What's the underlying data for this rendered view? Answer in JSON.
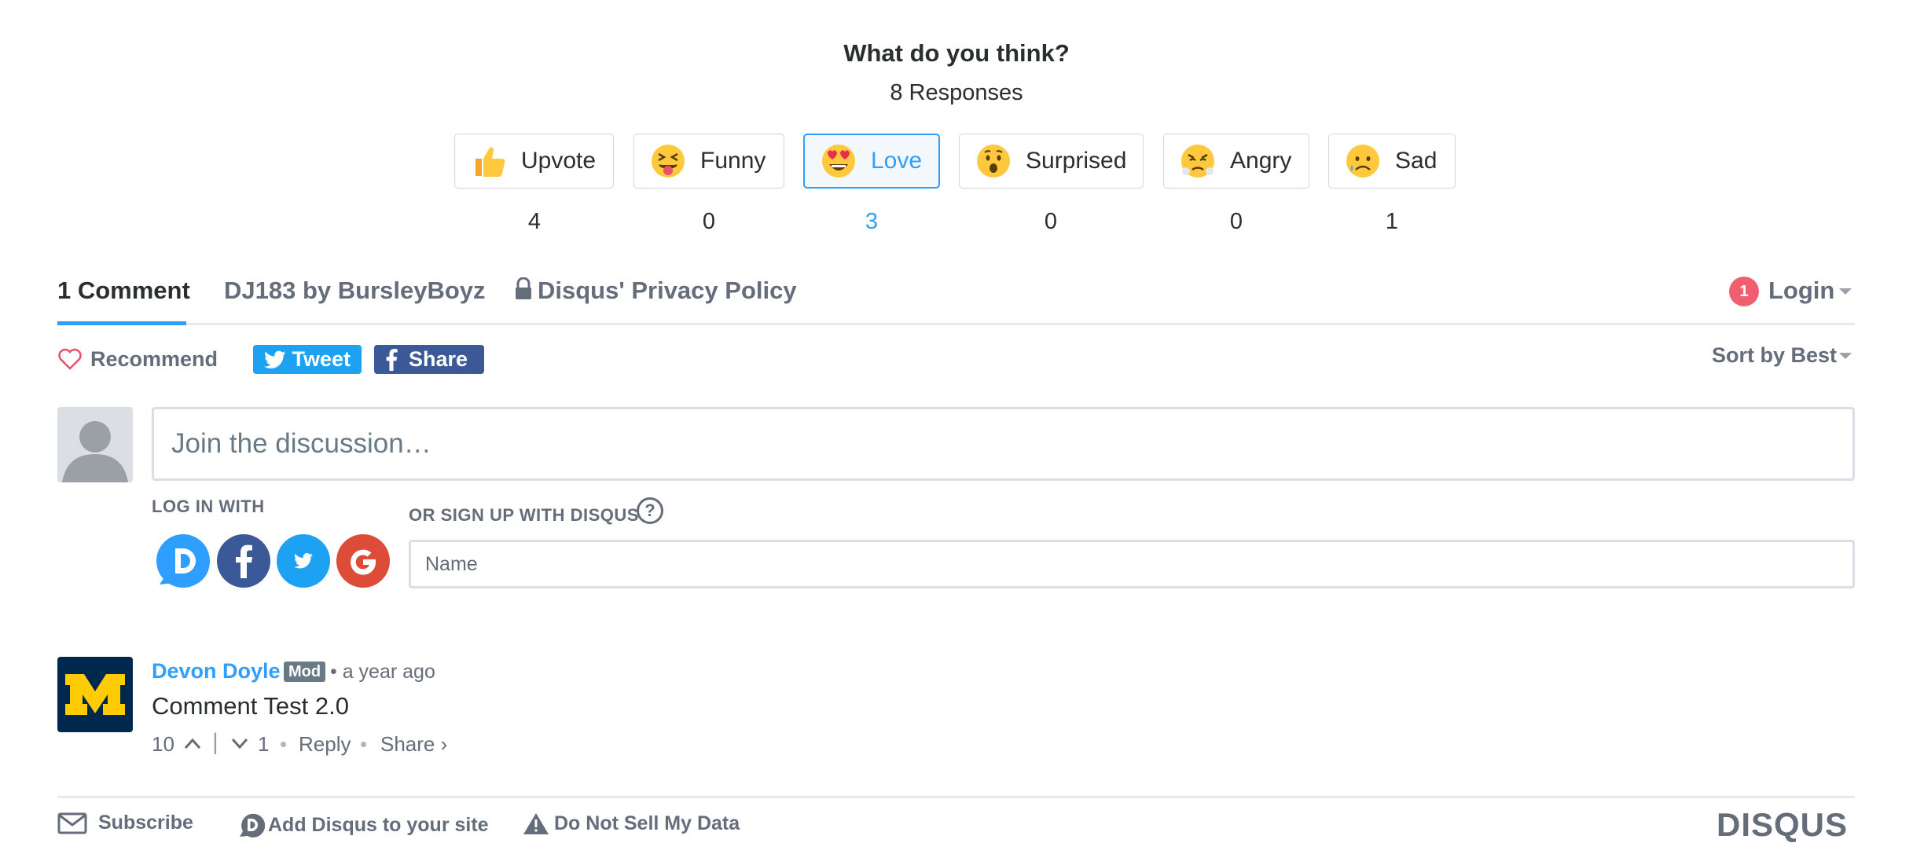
{
  "reactions_header": {
    "title": "What do you think?",
    "responses": "8 Responses"
  },
  "reactions": [
    {
      "label": "Upvote",
      "count": "4",
      "selected": false,
      "emoji": "thumbs-up-icon"
    },
    {
      "label": "Funny",
      "count": "0",
      "selected": false,
      "emoji": "tongue-squint-icon"
    },
    {
      "label": "Love",
      "count": "3",
      "selected": true,
      "emoji": "heart-eyes-icon"
    },
    {
      "label": "Surprised",
      "count": "0",
      "selected": false,
      "emoji": "hushed-face-icon"
    },
    {
      "label": "Angry",
      "count": "0",
      "selected": false,
      "emoji": "steam-face-icon"
    },
    {
      "label": "Sad",
      "count": "1",
      "selected": false,
      "emoji": "sad-sweat-icon"
    }
  ],
  "nav": {
    "comments_tab": "1 Comment",
    "community_tab": "DJ183 by BursleyBoyz",
    "privacy_tab": "Disqus' Privacy Policy",
    "login_badge": "1",
    "login_label": "Login"
  },
  "actions": {
    "recommend": "Recommend",
    "tweet": "Tweet",
    "share": "Share",
    "sort": "Sort by Best"
  },
  "composer": {
    "placeholder": "Join the discussion…",
    "login_with": "LOG IN WITH",
    "signup_with": "OR SIGN UP WITH DISQUS",
    "help": "?",
    "name_placeholder": "Name"
  },
  "comment": {
    "author": "Devon Doyle",
    "badge": "Mod",
    "time": "a year ago",
    "text": "Comment Test 2.0",
    "upvotes": "10",
    "downvotes": "1",
    "reply": "Reply",
    "share": "Share ›",
    "avatar_letter": "M"
  },
  "footer": {
    "subscribe": "Subscribe",
    "add_disqus": "Add Disqus to your site",
    "do_not_sell": "Do Not Sell My Data",
    "brand": "DISQUS"
  },
  "colors": {
    "accent": "#2e9fff",
    "twitter": "#1da1f2",
    "facebook": "#3b5998",
    "google": "#dd4b39",
    "badge": "#f05f70",
    "michigan_blue": "#00274c",
    "michigan_maize": "#ffcb05"
  }
}
